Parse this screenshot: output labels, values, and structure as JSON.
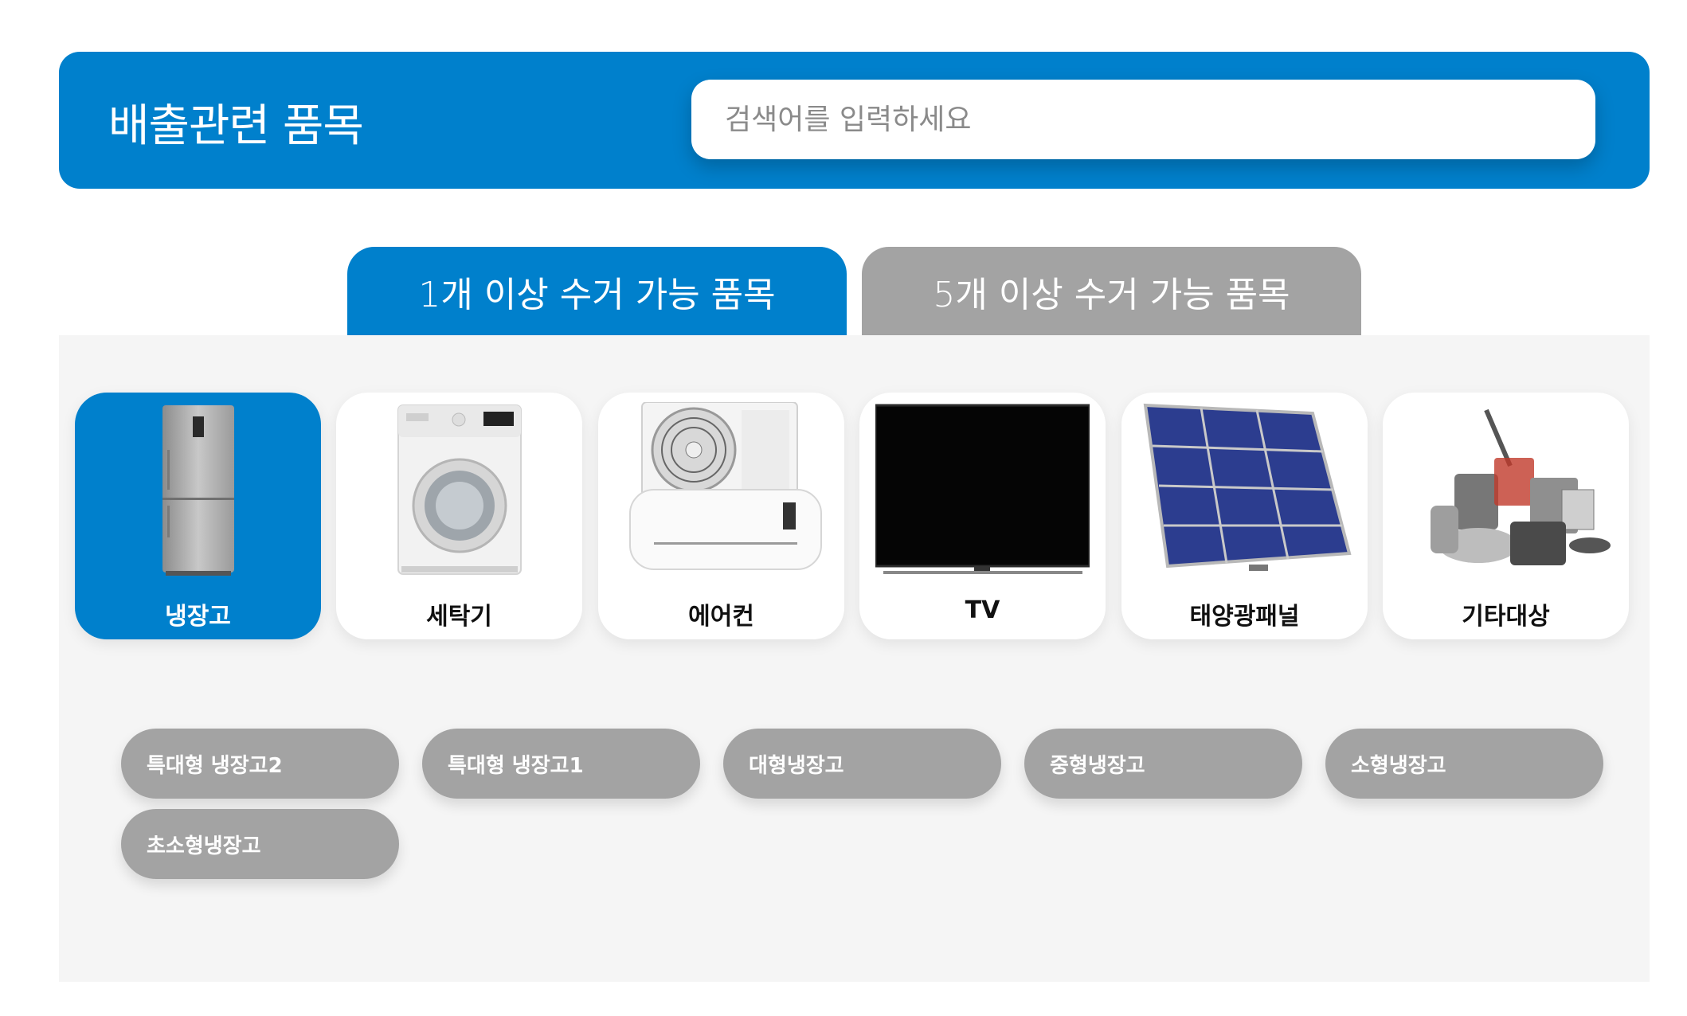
{
  "header": {
    "title": "배출관련 품목",
    "search_placeholder": "검색어를 입력하세요"
  },
  "tabs": [
    {
      "label": "1개 이상 수거 가능 품목",
      "active": true
    },
    {
      "label": "5개 이상 수거 가능 품목",
      "active": false
    }
  ],
  "categories": [
    {
      "label": "냉장고",
      "icon": "refrigerator-icon",
      "active": true
    },
    {
      "label": "세탁기",
      "icon": "washing-machine-icon",
      "active": false
    },
    {
      "label": "에어컨",
      "icon": "air-conditioner-icon",
      "active": false
    },
    {
      "label": "TV",
      "icon": "tv-icon",
      "active": false
    },
    {
      "label": "태양광패널",
      "icon": "solar-panel-icon",
      "active": false
    },
    {
      "label": "기타대상",
      "icon": "appliances-icon",
      "active": false
    }
  ],
  "subitems": [
    "특대형 냉장고2",
    "특대형 냉장고1",
    "대형냉장고",
    "중형냉장고",
    "소형냉장고",
    "초소형냉장고"
  ],
  "colors": {
    "accent": "#0080cc",
    "inactive": "#a3a3a3",
    "panel": "#f5f5f5"
  }
}
